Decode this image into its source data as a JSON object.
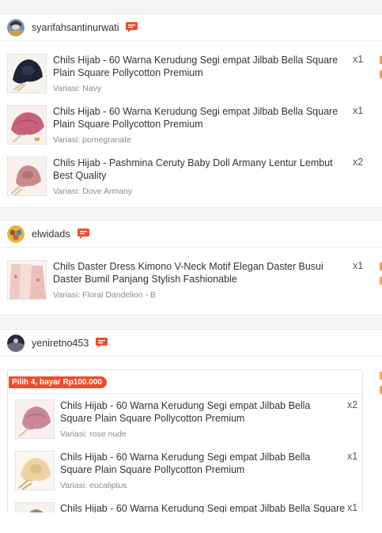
{
  "colors": {
    "accent": "#ee4d2d",
    "chat": "#ee4d2d"
  },
  "icons": {
    "chat": "chat-bubble-icon"
  },
  "shops": [
    {
      "name": "syarifahsantinurwati",
      "items": [
        {
          "title": "Chils Hijab - 60 Warna Kerudung Segi empat Jilbab Bella Square Plain Square Pollycotton Premium",
          "qty": "x1",
          "variant": "Variasi: Navy"
        },
        {
          "title": "Chils Hijab - 60 Warna Kerudung Segi empat Jilbab Bella Square Plain Square Pollycotton Premium",
          "qty": "x1",
          "variant": "Variasi: pomegranate"
        },
        {
          "title": "Chils Hijab - Pashmina Ceruty Baby Doll Armany Lentur Lembut Best Quality",
          "qty": "x2",
          "variant": "Variasi: Dove Armany"
        }
      ]
    },
    {
      "name": "elwidads",
      "items": [
        {
          "title": "Chils Daster Dress Kimono V-Neck Motif Elegan Daster Busui Daster Bumil Panjang Stylish Fashionable",
          "qty": "x1",
          "variant": "Variasi: Floral Dandelion - B"
        }
      ]
    },
    {
      "name": "yeniretno453",
      "promo": "Pilih 4, bayar Rp100.000",
      "items": [
        {
          "title": "Chils Hijab - 60 Warna Kerudung Segi empat Jilbab Bella Square Plain Square Pollycotton Premium",
          "qty": "x2",
          "variant": "Variasi: rose nude"
        },
        {
          "title": "Chils Hijab - 60 Warna Kerudung Segi empat Jilbab Bella Square Plain Square Pollycotton Premium",
          "qty": "x1",
          "variant": "Variasi: eucaliptus"
        },
        {
          "title": "Chils Hijab - 60 Warna Kerudung Segi empat Jilbab Bella Square",
          "qty": "x1"
        }
      ]
    }
  ]
}
